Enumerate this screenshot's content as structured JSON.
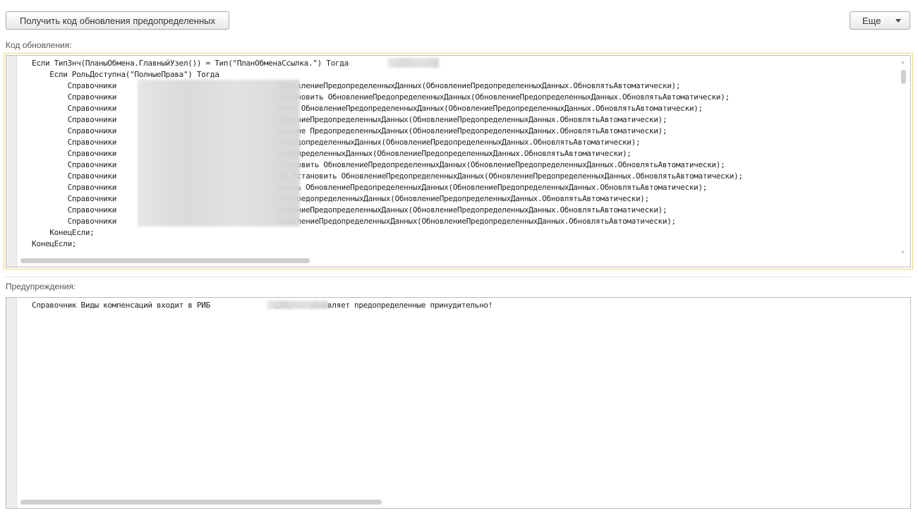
{
  "toolbar": {
    "get_code_label": "Получить код обновления предопределенных",
    "more_label": "Еще"
  },
  "update_code": {
    "caption": "Код обновления:",
    "lines": [
      "Если ТипЗнч(ПланыОбмена.ГлавныйУзел()) = Тип(\"ПланОбменаСсылка.\") Тогда",
      "    Если РольДоступна(\"ПолныеПрава\") Тогда",
      "        Справочники",
      "        Справочники",
      "        Справочники",
      "        Справочники",
      "        Справочники",
      "        Справочники",
      "        Справочники",
      "        Справочники",
      "        Справочники",
      "        Справочники",
      "        Справочники",
      "        Справочники",
      "        Справочники",
      "    КонецЕсли;",
      "КонецЕсли;"
    ],
    "line_tails": [
      "ОбновлениеПредопределенныхДанных(ОбновлениеПредопределенныхДанных.ОбновлятьАвтоматически);",
      "Установить ОбновлениеПредопределенныхДанных(ОбновлениеПредопределенныхДанных.ОбновлятьАвтоматически);",
      "вить ОбновлениеПредопределенныхДанных(ОбновлениеПредопределенныхДанных.ОбновлятьАвтоматически);",
      "овлениеПредопределенныхДанных(ОбновлениеПредопределенныхДанных.ОбновлятьАвтоматически);",
      "вление ПредопределенныхДанных(ОбновлениеПредопределенныхДанных.ОбновлятьАвтоматически);",
      "еПредопределенныхДанных(ОбновлениеПредопределенныхДанных.ОбновлятьАвтоматически);",
      "редопределенныхДанных(ОбновлениеПредопределенныхДанных.ОбновлятьАвтоматически);",
      "становить ОбновлениеПредопределенныхДанных(ОбновлениеПредопределенныхДанных.ОбновлятьАвтоматически);",
      "ты.Установить ОбновлениеПредопределенныхДанных(ОбновлениеПредопределенныхДанных.ОбновлятьАвтоматически);",
      "овить ОбновлениеПредопределенныхДанных(ОбновлениеПредопределенныхДанных.ОбновлятьАвтоматически);",
      "ниеПредопределенныхДанных(ОбновлениеПредопределенныхДанных.ОбновлятьАвтоматически);",
      "овлениеПредопределенныхДанных(ОбновлениеПредопределенныхДанных.ОбновлятьАвтоматически);",
      "бновлениеПредопределенныхДанных(ОбновлениеПредопределенныхДанных.ОбновлятьАвтоматически);"
    ]
  },
  "warnings": {
    "caption": "Предупреждения:",
    "text_before": "Справочник Виды компенсаций входит в РИБ ",
    "text_after": "ЦЗО, но обновляет предопределенные принудительно!"
  }
}
